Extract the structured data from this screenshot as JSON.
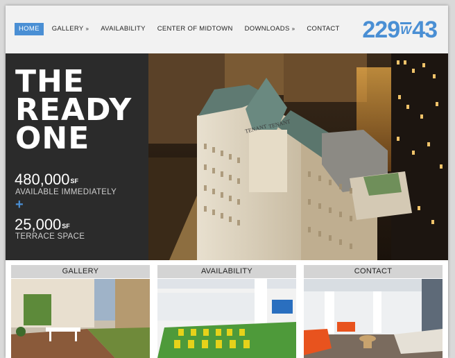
{
  "nav": {
    "items": [
      {
        "label": "HOME",
        "caret": "",
        "active": true
      },
      {
        "label": "GALLERY",
        "caret": "»",
        "active": false
      },
      {
        "label": "AVAILABILITY",
        "caret": "",
        "active": false
      },
      {
        "label": "CENTER OF MIDTOWN",
        "caret": "",
        "active": false
      },
      {
        "label": "DOWNLOADS",
        "caret": "»",
        "active": false
      },
      {
        "label": "CONTACT",
        "caret": "",
        "active": false
      }
    ]
  },
  "logo": {
    "left": "229",
    "mid": "W",
    "right": "43"
  },
  "hero": {
    "headline": [
      "THE",
      "READY",
      "ONE"
    ],
    "stat1": {
      "value": "480,000",
      "unit": "SF",
      "label": "AVAILABLE IMMEDIATELY"
    },
    "plus": "+",
    "stat2": {
      "value": "25,000",
      "unit": "SF",
      "label": "TERRACE SPACE"
    },
    "sign": [
      "TENANT",
      "TENANT"
    ]
  },
  "cards": [
    {
      "label": "GALLERY"
    },
    {
      "label": "AVAILABILITY"
    },
    {
      "label": "CONTACT"
    }
  ],
  "colors": {
    "accent": "#4a8fd4",
    "dark_panel": "#2b2b2b",
    "card_bar": "#d4d4d4"
  }
}
